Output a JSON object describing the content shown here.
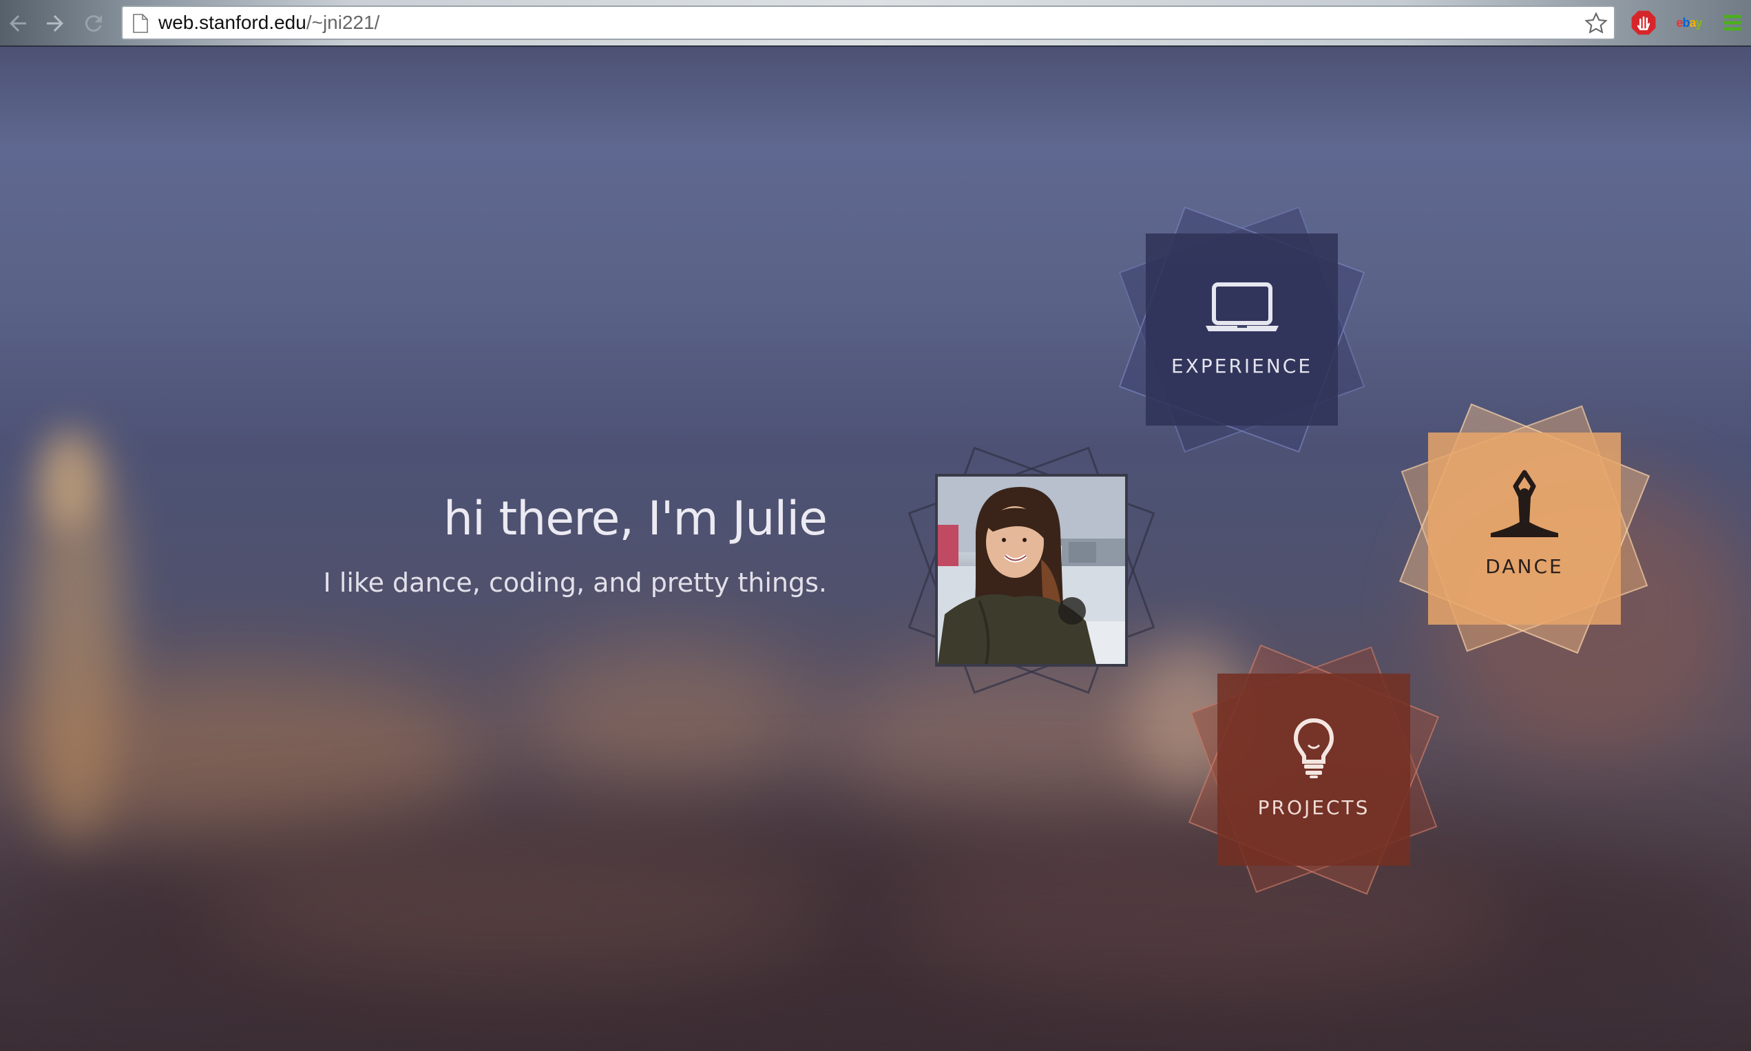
{
  "browser": {
    "url_host": "web.stanford.edu",
    "url_path": "/~jni221/",
    "extensions": {
      "stop_icon": "stop-hand-icon",
      "ebay_label": "ebay",
      "menu_icon": "hamburger-menu-icon"
    }
  },
  "hero": {
    "title": "hi there, I'm Julie",
    "subtitle": "I like dance, coding, and pretty things."
  },
  "tiles": {
    "experience": {
      "label": "EXPERIENCE",
      "icon": "laptop-icon"
    },
    "dance": {
      "label": "DANCE",
      "icon": "dancer-icon"
    },
    "projects": {
      "label": "PROJECTS",
      "icon": "lightbulb-icon"
    }
  },
  "colors": {
    "experience": "#303358",
    "dance": "#e7a66a",
    "projects": "#743023"
  }
}
